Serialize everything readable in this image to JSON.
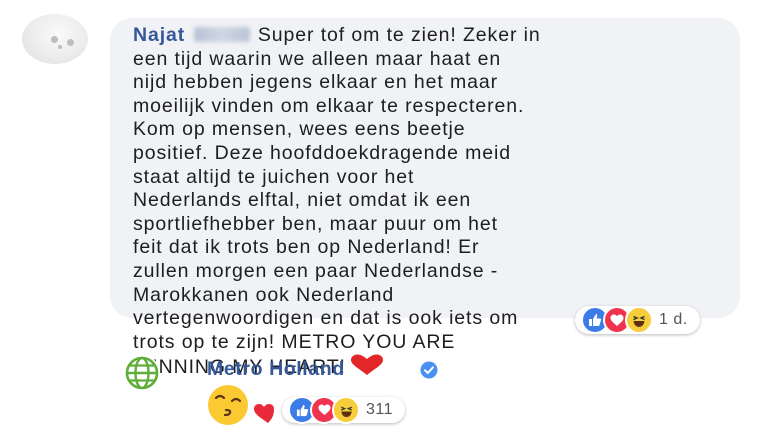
{
  "comment": {
    "author_first_name": "Najat",
    "author_last_name_redacted": true,
    "lines": [
      "Super tof om te zien! Zeker in",
      "een tijd waarin we alleen maar haat en",
      "nijd hebben jegens elkaar en het maar",
      "moeilijk vinden om elkaar te respecteren.",
      "Kom op mensen, wees eens beetje",
      "positief. Deze hoofddoekdragende meid",
      "staat altijd te juichen voor het",
      "Nederlands elftal, niet omdat ik een",
      "sportliefhebber ben, maar puur om het",
      "feit dat ik trots ben op Nederland! Er",
      "zullen morgen een paar Nederlandse -",
      "Marokkanen ook Nederland",
      "vertegenwoordigen en dat is ook iets om",
      "trots op te zijn! METRO YOU ARE",
      "WINNING MY HEART!"
    ],
    "trailing_emoji": "red-heart",
    "reactions": [
      "like",
      "love",
      "haha"
    ],
    "timestamp": "1 d."
  },
  "reply": {
    "page_name": "Metro Holland",
    "verified": true,
    "sticker": "kissing-face-wink-heart",
    "reactions": [
      "like",
      "love",
      "haha"
    ],
    "reaction_count": "311"
  },
  "colors": {
    "author_blue": "#365899",
    "bubble_bg": "#f1f2f6",
    "like_blue": "#3b7ce6",
    "love_red": "#f0334f",
    "haha_yellow": "#f7cd3c",
    "verified_blue": "#4a8ff2",
    "globe_green": "#5fae3a"
  }
}
